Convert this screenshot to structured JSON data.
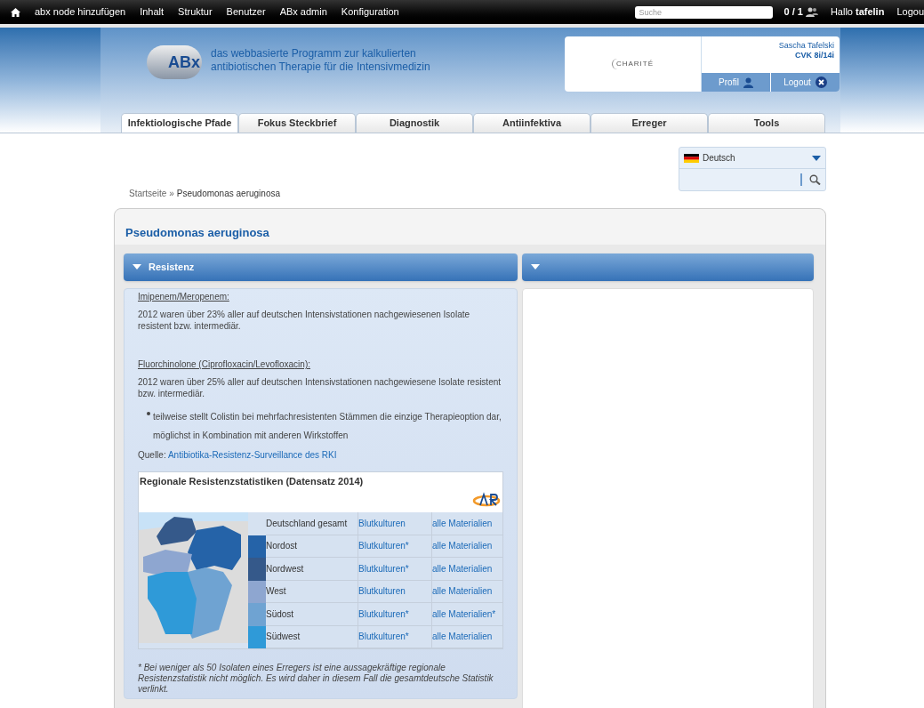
{
  "admin_bar": {
    "items": [
      "abx node hinzufügen",
      "Inhalt",
      "Struktur",
      "Benutzer",
      "ABx admin",
      "Konfiguration"
    ],
    "search": {
      "placeholder": "Suche"
    },
    "counter": "0 / 1",
    "greeting": "Hallo **tafelin**",
    "logout": "Logou"
  },
  "header": {
    "logo": "ABx",
    "tagline": "das webbasierte Programm zur kalkulierten antibiotischen Therapie für die Intensivmedizin",
    "partner": "CHARITÉ",
    "user_name": "Sascha Tafelski",
    "unit": "CVK 8i/14i",
    "profile": "Profil",
    "logout": "Logout"
  },
  "tabs": [
    {
      "label": "Infektiologische Pfade",
      "selected": true
    },
    {
      "label": "Fokus Steckbrief",
      "selected": false
    },
    {
      "label": "Diagnostik",
      "selected": false
    },
    {
      "label": "Antiinfektiva",
      "selected": false
    },
    {
      "label": "Erreger",
      "selected": false
    },
    {
      "label": "Tools",
      "selected": false
    }
  ],
  "language": {
    "value": "Deutsch"
  },
  "breadcrumb": [
    "Startseite",
    "»",
    "Pseudomonas aeruginosa"
  ],
  "page_title": "Pseudomonas aeruginosa",
  "left_panel": {
    "title": "Resistenz",
    "expanded": true,
    "sections": [
      {
        "heading": "Imipenem/Meropenem:",
        "text": "2012 waren über 23%  aller auf deutschen Intensivstationen nachgewiesenen Isolate resistent bzw. intermediär."
      },
      {
        "heading": "Fluorchinolone (Ciprofloxacin/Levofloxacin):",
        "text": "2012 waren über 25%  aller auf deutschen Intensivstationen nachgewiesene Isolate resistent bzw. intermediär."
      }
    ],
    "bullets": [
      "teilweise stellt Colistin bei mehrfachresistenten Stämmen die einzige Therapieoption dar, möglichst in Kombination mit anderen Wirkstoffen"
    ],
    "source_label": "Quelle:",
    "source_link": "Antibiotika-Resistenz-Surveillance des RKI",
    "stats": {
      "title": "Regionale Resistenzstatistiken (Datensatz 2014)",
      "rows": [
        {
          "region": "Deutschland gesamt",
          "blood": "Blutkulturen",
          "all": "alle Materialien"
        },
        {
          "region": "Nordost",
          "color": "#2563a8",
          "blood": "Blutkulturen*",
          "all": "alle Materialien"
        },
        {
          "region": "Nordwest",
          "color": "#35598a",
          "blood": "Blutkulturen*",
          "all": "alle Materialien"
        },
        {
          "region": "West",
          "color": "#8ea6d0",
          "blood": "Blutkulturen",
          "all": "alle Materialien"
        },
        {
          "region": "Südost",
          "color": "#6fa3d2",
          "blood": "Blutkulturen*",
          "all": "alle Materialien*"
        },
        {
          "region": "Südwest",
          "color": "#2f9ad8",
          "blood": "Blutkulturen*",
          "all": "alle Materialien"
        }
      ]
    },
    "footnote": "* Bei weniger als 50 Isolaten eines Erregers ist eine aussagekräftige regionale Resistenzstatistik nicht möglich. Es wird daher in diesem Fall die gesamtdeutsche Statistik verlinkt."
  },
  "right_panel": {
    "expanded": true
  }
}
